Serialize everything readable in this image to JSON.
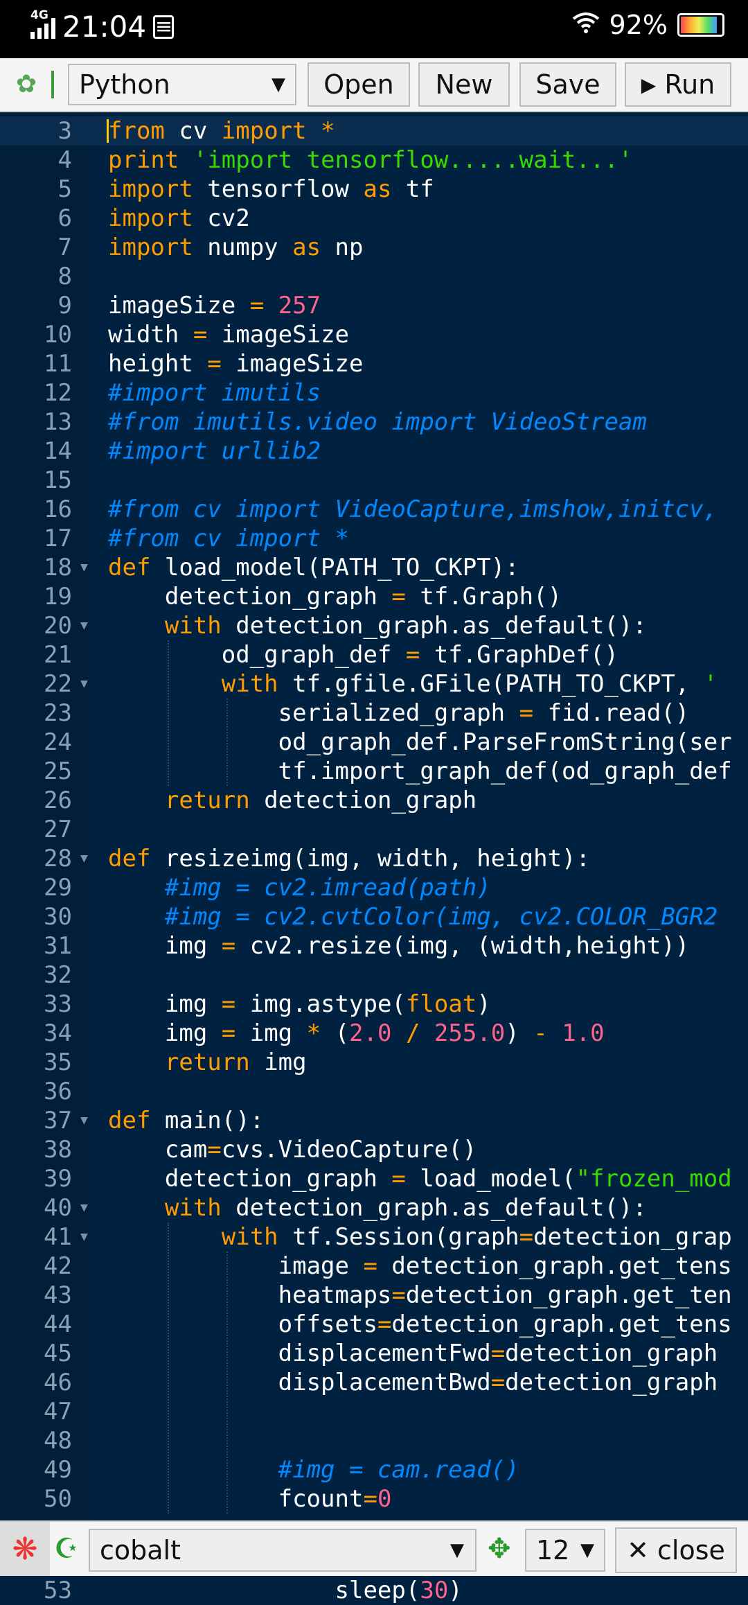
{
  "status_bar": {
    "network": "4G",
    "time": "21:04",
    "battery_percent": "92%",
    "battery_level": 0.92
  },
  "toolbar": {
    "language": "Python",
    "open_label": "Open",
    "new_label": "New",
    "save_label": "Save",
    "run_label": "Run"
  },
  "editor": {
    "active_line": 3,
    "colors": {
      "background": "#002240",
      "keyword": "#ff9d00",
      "string": "#3ad900",
      "number": "#ff628c",
      "comment": "#0088ff",
      "plain": "#ffffff"
    },
    "lines": [
      {
        "n": "3",
        "fold": false,
        "tokens": [
          [
            "k",
            "from"
          ],
          [
            "t",
            " cv "
          ],
          [
            "k",
            "import"
          ],
          [
            "t",
            " "
          ],
          [
            "o",
            "*"
          ]
        ]
      },
      {
        "n": "4",
        "fold": false,
        "tokens": [
          [
            "k",
            "print"
          ],
          [
            "t",
            " "
          ],
          [
            "s",
            "'import tensorflow.....wait...'"
          ]
        ]
      },
      {
        "n": "5",
        "fold": false,
        "tokens": [
          [
            "k",
            "import"
          ],
          [
            "t",
            " tensorflow "
          ],
          [
            "k",
            "as"
          ],
          [
            "t",
            " tf"
          ]
        ]
      },
      {
        "n": "6",
        "fold": false,
        "tokens": [
          [
            "k",
            "import"
          ],
          [
            "t",
            " cv2"
          ]
        ]
      },
      {
        "n": "7",
        "fold": false,
        "tokens": [
          [
            "k",
            "import"
          ],
          [
            "t",
            " numpy "
          ],
          [
            "k",
            "as"
          ],
          [
            "t",
            " np"
          ]
        ]
      },
      {
        "n": "8",
        "fold": false,
        "tokens": []
      },
      {
        "n": "9",
        "fold": false,
        "tokens": [
          [
            "t",
            "imageSize "
          ],
          [
            "o",
            "="
          ],
          [
            "t",
            " "
          ],
          [
            "n",
            "257"
          ]
        ]
      },
      {
        "n": "10",
        "fold": false,
        "tokens": [
          [
            "t",
            "width "
          ],
          [
            "o",
            "="
          ],
          [
            "t",
            " imageSize"
          ]
        ]
      },
      {
        "n": "11",
        "fold": false,
        "tokens": [
          [
            "t",
            "height "
          ],
          [
            "o",
            "="
          ],
          [
            "t",
            " imageSize"
          ]
        ]
      },
      {
        "n": "12",
        "fold": false,
        "tokens": [
          [
            "c",
            "#import imutils"
          ]
        ]
      },
      {
        "n": "13",
        "fold": false,
        "tokens": [
          [
            "c",
            "#from imutils.video import VideoStream"
          ]
        ]
      },
      {
        "n": "14",
        "fold": false,
        "tokens": [
          [
            "c",
            "#import urllib2"
          ]
        ]
      },
      {
        "n": "15",
        "fold": false,
        "tokens": []
      },
      {
        "n": "16",
        "fold": false,
        "tokens": [
          [
            "c",
            "#from cv import VideoCapture,imshow,initcv,"
          ]
        ]
      },
      {
        "n": "17",
        "fold": false,
        "tokens": [
          [
            "c",
            "#from cv import *"
          ]
        ]
      },
      {
        "n": "18",
        "fold": true,
        "tokens": [
          [
            "k",
            "def"
          ],
          [
            "t",
            " load_model(PATH_TO_CKPT):"
          ]
        ]
      },
      {
        "n": "19",
        "fold": false,
        "tokens": [
          [
            "t",
            "    detection_graph "
          ],
          [
            "o",
            "="
          ],
          [
            "t",
            " tf.Graph()"
          ]
        ]
      },
      {
        "n": "20",
        "fold": true,
        "tokens": [
          [
            "t",
            "    "
          ],
          [
            "k",
            "with"
          ],
          [
            "t",
            " detection_graph.as_default():"
          ]
        ]
      },
      {
        "n": "21",
        "fold": false,
        "tokens": [
          [
            "t",
            "        od_graph_def "
          ],
          [
            "o",
            "="
          ],
          [
            "t",
            " tf.GraphDef()"
          ]
        ]
      },
      {
        "n": "22",
        "fold": true,
        "tokens": [
          [
            "t",
            "        "
          ],
          [
            "k",
            "with"
          ],
          [
            "t",
            " tf.gfile.GFile(PATH_TO_CKPT, "
          ],
          [
            "s",
            "'"
          ]
        ]
      },
      {
        "n": "23",
        "fold": false,
        "tokens": [
          [
            "t",
            "            serialized_graph "
          ],
          [
            "o",
            "="
          ],
          [
            "t",
            " fid.read()"
          ]
        ]
      },
      {
        "n": "24",
        "fold": false,
        "tokens": [
          [
            "t",
            "            od_graph_def.ParseFromString(ser"
          ]
        ]
      },
      {
        "n": "25",
        "fold": false,
        "tokens": [
          [
            "t",
            "            tf.import_graph_def(od_graph_def"
          ]
        ]
      },
      {
        "n": "26",
        "fold": false,
        "tokens": [
          [
            "t",
            "    "
          ],
          [
            "k",
            "return"
          ],
          [
            "t",
            " detection_graph"
          ]
        ]
      },
      {
        "n": "27",
        "fold": false,
        "tokens": []
      },
      {
        "n": "28",
        "fold": true,
        "tokens": [
          [
            "k",
            "def"
          ],
          [
            "t",
            " resizeimg(img, width, height):"
          ]
        ]
      },
      {
        "n": "29",
        "fold": false,
        "tokens": [
          [
            "t",
            "    "
          ],
          [
            "c",
            "#img = cv2.imread(path)"
          ]
        ]
      },
      {
        "n": "30",
        "fold": false,
        "tokens": [
          [
            "t",
            "    "
          ],
          [
            "c",
            "#img = cv2.cvtColor(img, cv2.COLOR_BGR2"
          ]
        ]
      },
      {
        "n": "31",
        "fold": false,
        "tokens": [
          [
            "t",
            "    img "
          ],
          [
            "o",
            "="
          ],
          [
            "t",
            " cv2.resize(img, (width,height))"
          ]
        ]
      },
      {
        "n": "32",
        "fold": false,
        "tokens": []
      },
      {
        "n": "33",
        "fold": false,
        "tokens": [
          [
            "t",
            "    img "
          ],
          [
            "o",
            "="
          ],
          [
            "t",
            " img.astype("
          ],
          [
            "k",
            "float"
          ],
          [
            "t",
            ")"
          ]
        ]
      },
      {
        "n": "34",
        "fold": false,
        "tokens": [
          [
            "t",
            "    img "
          ],
          [
            "o",
            "="
          ],
          [
            "t",
            " img "
          ],
          [
            "o",
            "*"
          ],
          [
            "t",
            " ("
          ],
          [
            "n",
            "2.0"
          ],
          [
            "t",
            " "
          ],
          [
            "o",
            "/"
          ],
          [
            "t",
            " "
          ],
          [
            "n",
            "255.0"
          ],
          [
            "t",
            ") "
          ],
          [
            "o",
            "-"
          ],
          [
            "t",
            " "
          ],
          [
            "n",
            "1.0"
          ]
        ]
      },
      {
        "n": "35",
        "fold": false,
        "tokens": [
          [
            "t",
            "    "
          ],
          [
            "k",
            "return"
          ],
          [
            "t",
            " img"
          ]
        ]
      },
      {
        "n": "36",
        "fold": false,
        "tokens": []
      },
      {
        "n": "37",
        "fold": true,
        "tokens": [
          [
            "k",
            "def"
          ],
          [
            "t",
            " main():"
          ]
        ]
      },
      {
        "n": "38",
        "fold": false,
        "tokens": [
          [
            "t",
            "    cam"
          ],
          [
            "o",
            "="
          ],
          [
            "t",
            "cvs.VideoCapture()"
          ]
        ]
      },
      {
        "n": "39",
        "fold": false,
        "tokens": [
          [
            "t",
            "    detection_graph "
          ],
          [
            "o",
            "="
          ],
          [
            "t",
            " load_model("
          ],
          [
            "s",
            "\"frozen_mod"
          ]
        ]
      },
      {
        "n": "40",
        "fold": true,
        "tokens": [
          [
            "t",
            "    "
          ],
          [
            "k",
            "with"
          ],
          [
            "t",
            " detection_graph.as_default():"
          ]
        ]
      },
      {
        "n": "41",
        "fold": true,
        "tokens": [
          [
            "t",
            "        "
          ],
          [
            "k",
            "with"
          ],
          [
            "t",
            " tf.Session(graph"
          ],
          [
            "o",
            "="
          ],
          [
            "t",
            "detection_grap"
          ]
        ]
      },
      {
        "n": "42",
        "fold": false,
        "tokens": [
          [
            "t",
            "            image "
          ],
          [
            "o",
            "="
          ],
          [
            "t",
            " detection_graph.get_tens"
          ]
        ]
      },
      {
        "n": "43",
        "fold": false,
        "tokens": [
          [
            "t",
            "            heatmaps"
          ],
          [
            "o",
            "="
          ],
          [
            "t",
            "detection_graph.get_ten"
          ]
        ]
      },
      {
        "n": "44",
        "fold": false,
        "tokens": [
          [
            "t",
            "            offsets"
          ],
          [
            "o",
            "="
          ],
          [
            "t",
            "detection_graph.get_tens"
          ]
        ]
      },
      {
        "n": "45",
        "fold": false,
        "tokens": [
          [
            "t",
            "            displacementFwd"
          ],
          [
            "o",
            "="
          ],
          [
            "t",
            "detection_graph"
          ]
        ]
      },
      {
        "n": "46",
        "fold": false,
        "tokens": [
          [
            "t",
            "            displacementBwd"
          ],
          [
            "o",
            "="
          ],
          [
            "t",
            "detection_graph"
          ]
        ]
      },
      {
        "n": "47",
        "fold": false,
        "tokens": []
      },
      {
        "n": "48",
        "fold": false,
        "tokens": []
      },
      {
        "n": "49",
        "fold": false,
        "tokens": [
          [
            "t",
            "            "
          ],
          [
            "c",
            "#img = cam.read()"
          ]
        ]
      },
      {
        "n": "50",
        "fold": false,
        "tokens": [
          [
            "t",
            "            fcount"
          ],
          [
            "o",
            "="
          ],
          [
            "n",
            "0"
          ]
        ]
      }
    ],
    "bottom_line": {
      "n": "53",
      "tokens": [
        [
          "t",
          "                sleep("
        ],
        [
          "n",
          "30"
        ],
        [
          "t",
          ")"
        ]
      ]
    }
  },
  "bottom_bar": {
    "theme": "cobalt",
    "font_size": "12",
    "close_label": "close"
  }
}
